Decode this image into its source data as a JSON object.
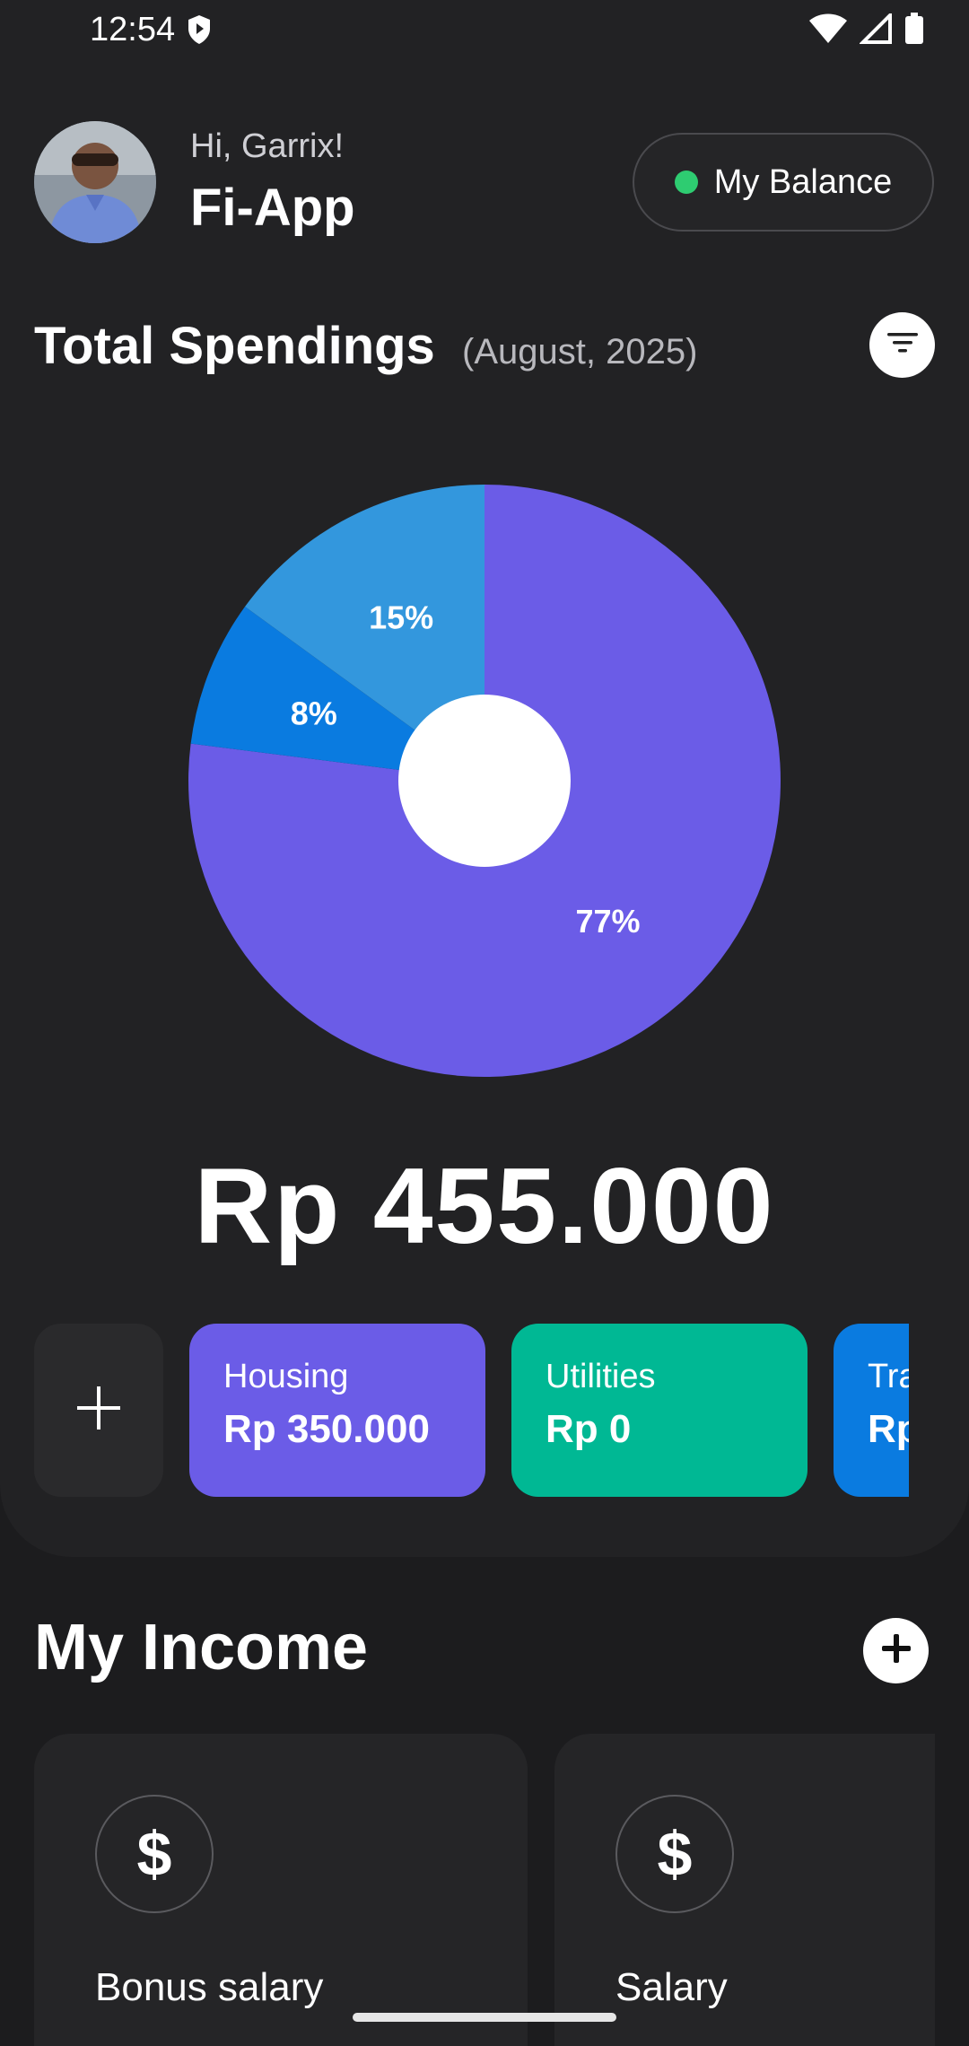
{
  "status_bar": {
    "time": "12:54"
  },
  "header": {
    "greeting": "Hi, Garrix!",
    "app_name": "Fi-App",
    "balance_button": "My Balance"
  },
  "spendings": {
    "title": "Total Spendings",
    "period": "(August, 2025)",
    "total": "Rp 455.000"
  },
  "chart_data": {
    "type": "pie",
    "style": "donut",
    "slices": [
      {
        "label": "77%",
        "value": 77,
        "color": "#6b5ce7"
      },
      {
        "label": "8%",
        "value": 8,
        "color": "#0a7be0"
      },
      {
        "label": "15%",
        "value": 15,
        "color": "#3397dd"
      }
    ]
  },
  "categories": [
    {
      "name": "Housing",
      "amount": "Rp 350.000",
      "color": "#6b5ce7"
    },
    {
      "name": "Utilities",
      "amount": "Rp 0",
      "color": "#00b894"
    },
    {
      "name": "Tra",
      "amount": "Rp",
      "color": "#0a7be0"
    }
  ],
  "income": {
    "title": "My Income",
    "items": [
      {
        "name": "Bonus salary",
        "icon": "$"
      },
      {
        "name": "Salary",
        "icon": "$"
      }
    ]
  },
  "colors": {
    "accent": "#6b5ce7",
    "online": "#2ecc71"
  }
}
